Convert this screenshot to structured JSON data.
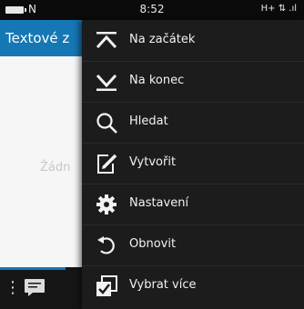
{
  "status_bar": {
    "notification": "N",
    "time": "8:52",
    "network": "H+ ⇅ .ıl"
  },
  "app": {
    "title": "Textové z",
    "empty_text": "Žádn"
  },
  "menu": {
    "items": [
      {
        "label": "Na začátek",
        "icon": "to-top-icon"
      },
      {
        "label": "Na konec",
        "icon": "to-bottom-icon"
      },
      {
        "label": "Hledat",
        "icon": "search-icon"
      },
      {
        "label": "Vytvořit",
        "icon": "compose-icon"
      },
      {
        "label": "Nastavení",
        "icon": "gear-icon"
      },
      {
        "label": "Obnovit",
        "icon": "refresh-icon"
      },
      {
        "label": "Vybrat více",
        "icon": "select-multiple-icon"
      }
    ]
  },
  "colors": {
    "accent": "#1577b4",
    "menu_bg": "#1c1c1c",
    "bar_bg": "#161616"
  }
}
